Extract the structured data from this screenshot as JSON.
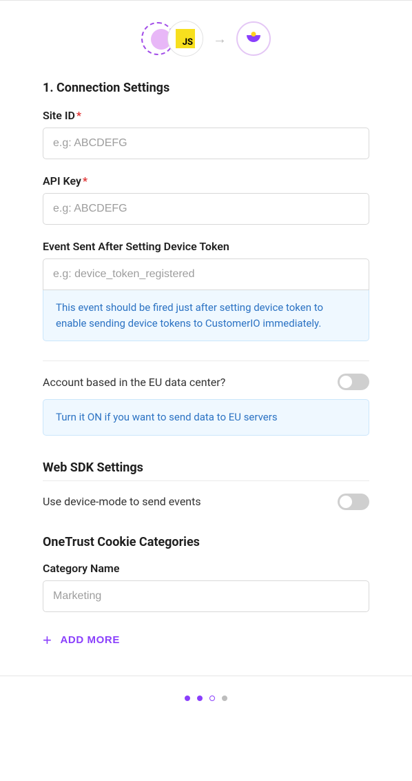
{
  "header": {
    "src_badge": "JS",
    "arrow": "→"
  },
  "section1": {
    "title": "1. Connection Settings",
    "site_id": {
      "label": "Site ID",
      "placeholder": "e.g: ABCDEFG",
      "value": ""
    },
    "api_key": {
      "label": "API Key",
      "placeholder": "e.g: ABCDEFG",
      "value": ""
    },
    "event": {
      "label": "Event Sent After Setting Device Token",
      "placeholder": "e.g: device_token_registered",
      "value": ""
    },
    "event_info": "This event should be fired just after setting device token to enable sending device tokens to CustomerIO immediately.",
    "eu_toggle": {
      "label": "Account based in the EU data center?",
      "info": "Turn it ON if you want to send data to EU servers"
    }
  },
  "section2": {
    "title": "Web SDK Settings",
    "device_mode": {
      "label": "Use device-mode to send events"
    }
  },
  "section3": {
    "title": "OneTrust Cookie Categories",
    "category": {
      "label": "Category Name",
      "placeholder": "Marketing",
      "value": ""
    },
    "add_more": "ADD MORE"
  }
}
